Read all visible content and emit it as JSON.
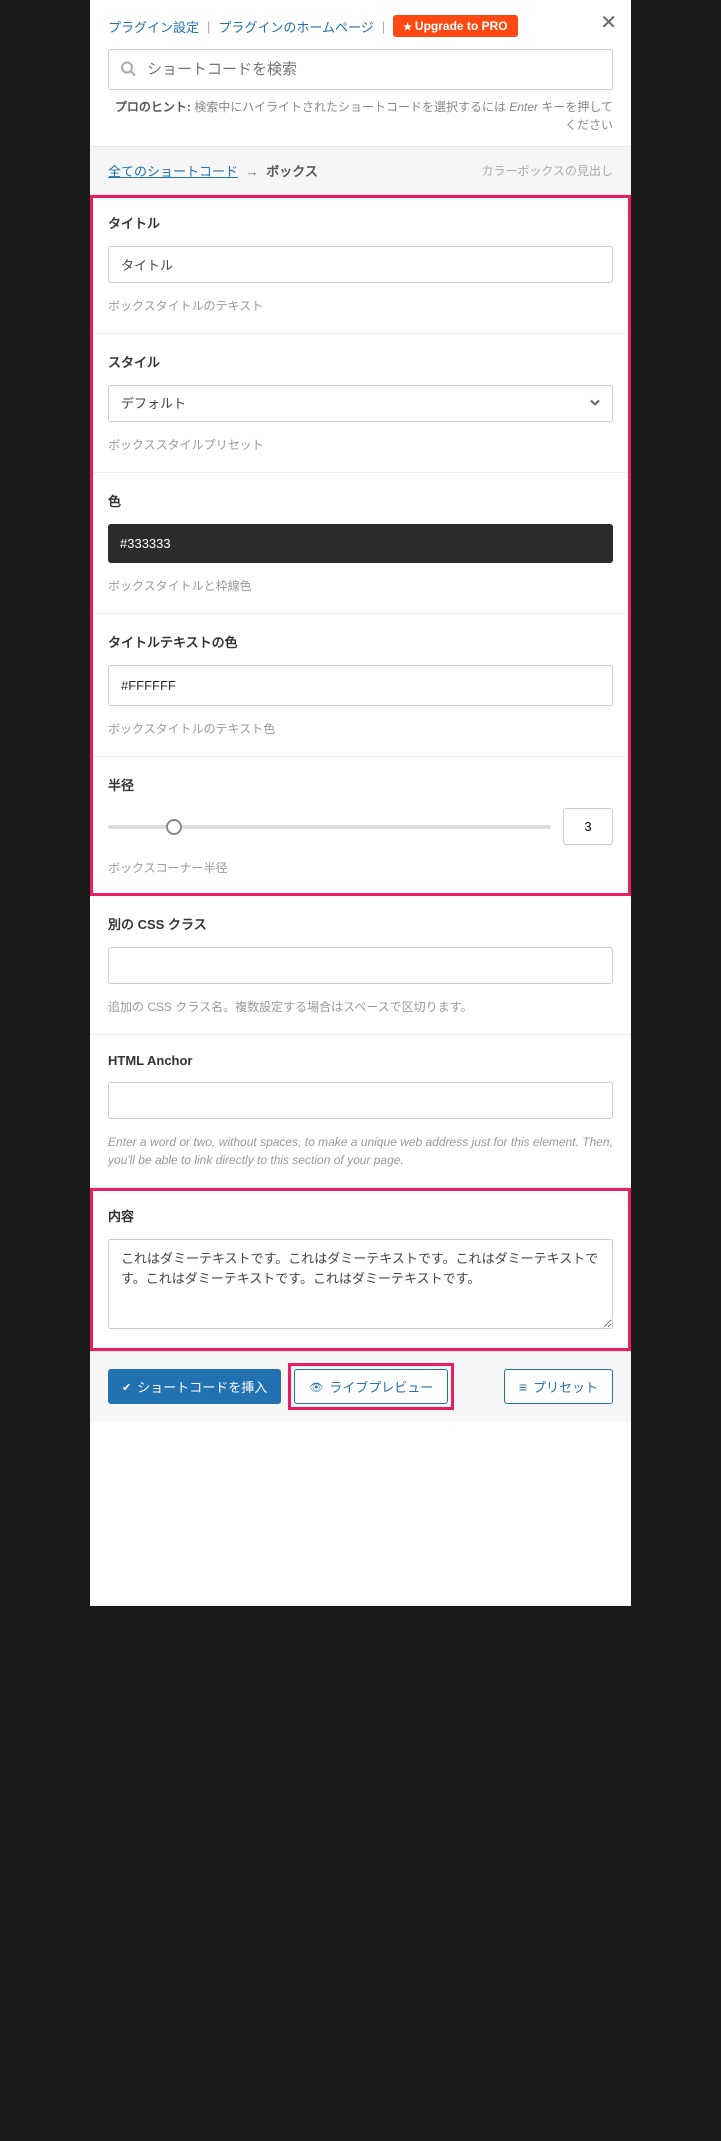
{
  "header": {
    "link_plugin_settings": "プラグイン設定",
    "link_plugin_homepage": "プラグインのホームページ",
    "upgrade_label": "Upgrade to PRO"
  },
  "search": {
    "placeholder": "ショートコードを検索",
    "hint_prefix": "プロのヒント:",
    "hint_text": " 検索中にハイライトされたショートコードを選択するには ",
    "hint_key": "Enter",
    "hint_suffix": " キーを押してください"
  },
  "breadcrumb": {
    "all_link": "全てのショートコード",
    "arrow": "→",
    "current": "ボックス",
    "subtitle": "カラーボックスの見出し"
  },
  "fields": {
    "title": {
      "label": "タイトル",
      "value": "タイトル",
      "help": "ボックスタイトルのテキスト"
    },
    "style": {
      "label": "スタイル",
      "value": "デフォルト",
      "help": "ボックススタイルプリセット"
    },
    "color": {
      "label": "色",
      "value": "#333333",
      "help": "ボックスタイトルと枠線色"
    },
    "title_color": {
      "label": "タイトルテキストの色",
      "value": "#FFFFFF",
      "help": "ボックスタイトルのテキスト色"
    },
    "radius": {
      "label": "半径",
      "value": "3",
      "help": "ボックスコーナー半径"
    },
    "css_class": {
      "label": "別の CSS クラス",
      "value": "",
      "help": "追加の CSS クラス名。複数設定する場合はスペースで区切ります。"
    },
    "anchor": {
      "label": "HTML Anchor",
      "value": "",
      "help": "Enter a word or two, without spaces, to make a unique web address just for this element. Then, you'll be able to link directly to this section of your page."
    },
    "content": {
      "label": "内容",
      "value": "これはダミーテキストです。これはダミーテキストです。これはダミーテキストです。これはダミーテキストです。これはダミーテキストです。"
    }
  },
  "footer": {
    "insert": "ショートコードを挿入",
    "preview": "ライブプレビュー",
    "preset": "プリセット"
  }
}
